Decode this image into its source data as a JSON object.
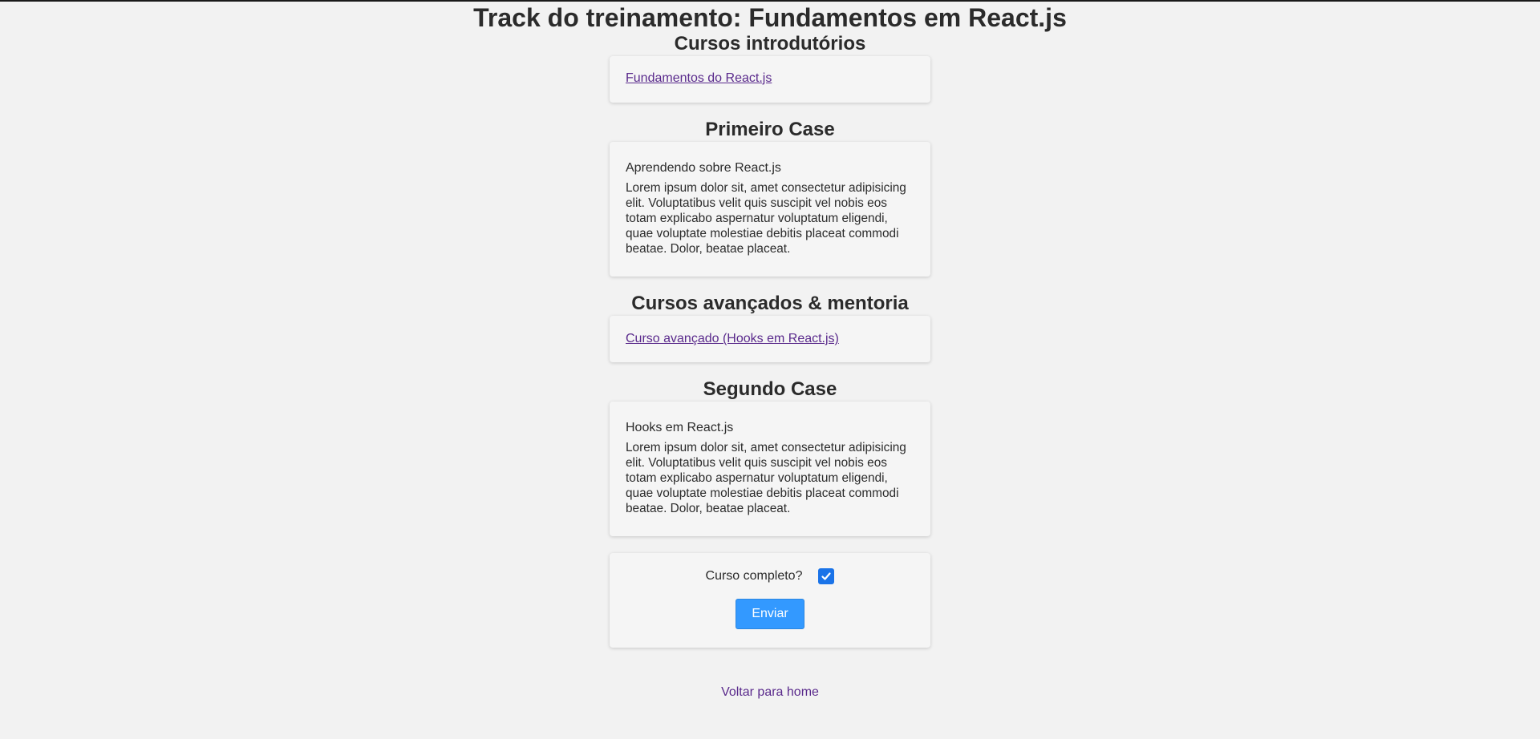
{
  "page": {
    "title": "Track do treinamento: Fundamentos em React.js"
  },
  "sections": {
    "intro": {
      "title": "Cursos introdutórios",
      "link_label": "Fundamentos do React.js"
    },
    "case1": {
      "title": "Primeiro Case",
      "subtitle": "Aprendendo sobre React.js",
      "text": "Lorem ipsum dolor sit, amet consectetur adipisicing elit. Voluptatibus velit quis suscipit vel nobis eos totam explicabo aspernatur voluptatum eligendi, quae voluptate molestiae debitis placeat commodi beatae. Dolor, beatae placeat."
    },
    "advanced": {
      "title": "Cursos avançados & mentoria",
      "link_label": "Curso avançado (Hooks em React.js)"
    },
    "case2": {
      "title": "Segundo Case",
      "subtitle": "Hooks em React.js",
      "text": "Lorem ipsum dolor sit, amet consectetur adipisicing elit. Voluptatibus velit quis suscipit vel nobis eos totam explicabo aspernatur voluptatum eligendi, quae voluptate molestiae debitis placeat commodi beatae. Dolor, beatae placeat."
    }
  },
  "form": {
    "checkbox_label": "Curso completo?",
    "checked": true,
    "submit_label": "Enviar"
  },
  "footer": {
    "back_label": "Voltar para home"
  },
  "icons": {
    "checkbox_icon": "check-icon"
  },
  "colors": {
    "background": "#f2f2f2",
    "card": "#f5f5f5",
    "link": "#5a2a8c",
    "button": "#3399ff",
    "checkbox": "#1a73e8"
  }
}
